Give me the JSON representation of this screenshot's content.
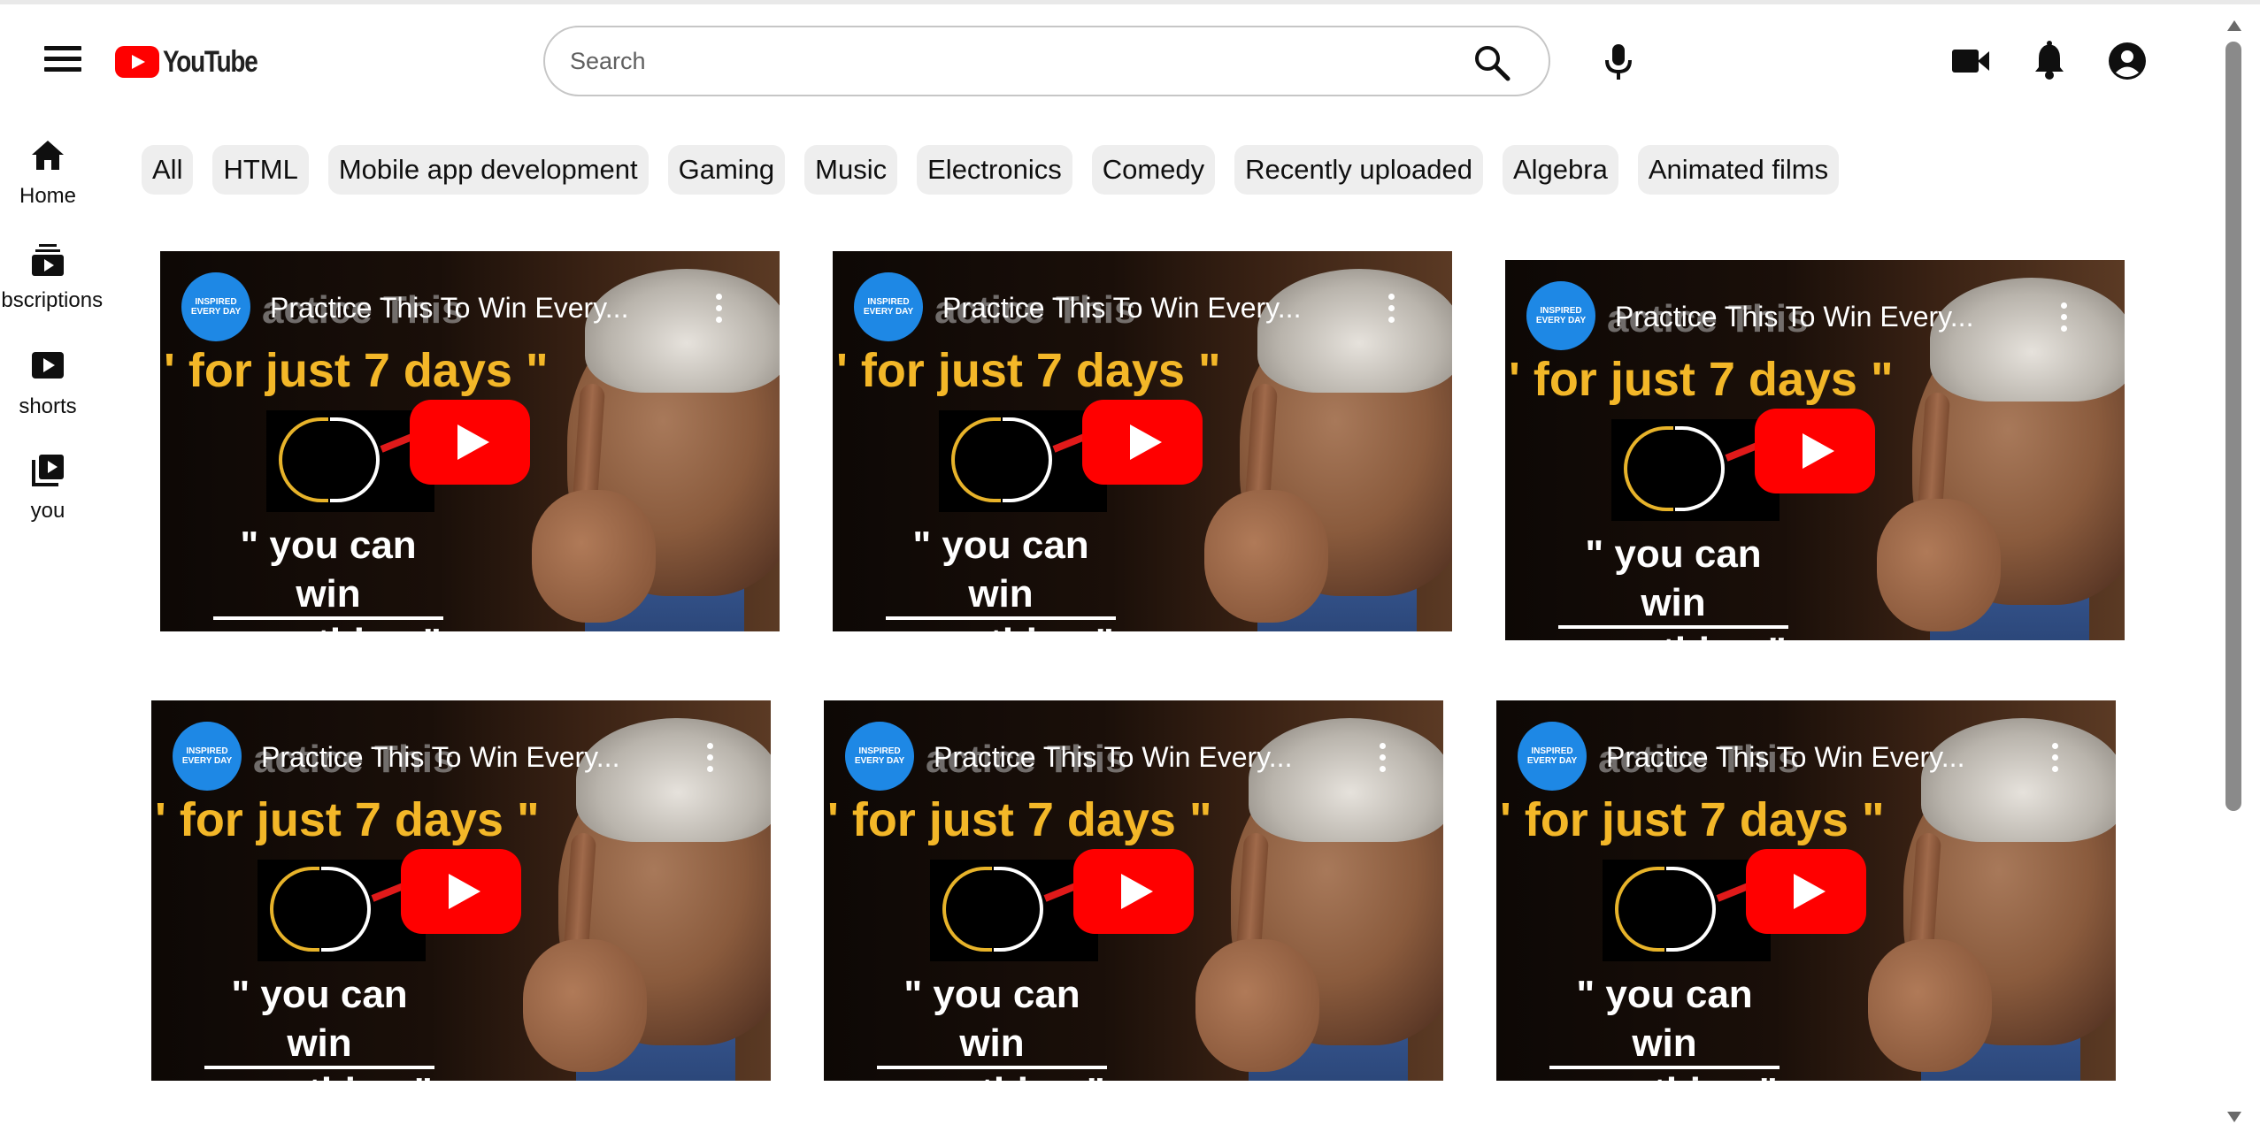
{
  "header": {
    "logo_text": "YouTube",
    "search": {
      "placeholder": "Search",
      "value": ""
    }
  },
  "sidebar": {
    "items": [
      {
        "label": "Home",
        "icon": "home-icon"
      },
      {
        "label": "ubscriptions",
        "icon": "subscriptions-icon"
      },
      {
        "label": "shorts",
        "icon": "shorts-icon"
      },
      {
        "label": "you",
        "icon": "you-icon"
      }
    ]
  },
  "chips": [
    "All",
    "HTML",
    "Mobile app development",
    "Gaming",
    "Music",
    "Electronics",
    "Comedy",
    "Recently uploaded",
    "Algebra",
    "Animated films"
  ],
  "videos": [
    {
      "channel": "INSPIRED EVERY DAY",
      "title": "Practice This To Win Every...",
      "ghost": "actice This",
      "line1": "' for just 7 days \"",
      "line2": "\" you can win everything \""
    },
    {
      "channel": "INSPIRED EVERY DAY",
      "title": "Practice This To Win Every...",
      "ghost": "actice This",
      "line1": "' for just 7 days \"",
      "line2": "\" you can win everything \""
    },
    {
      "channel": "INSPIRED EVERY DAY",
      "title": "Practice This To Win Every...",
      "ghost": "actice This",
      "line1": "' for just 7 days \"",
      "line2": "\" you can win everything \""
    },
    {
      "channel": "INSPIRED EVERY DAY",
      "title": "Practice This To Win Every...",
      "ghost": "actice This",
      "line1": "' for just 7 days \"",
      "line2": "\" you can win everything \""
    },
    {
      "channel": "INSPIRED EVERY DAY",
      "title": "Practice This To Win Every...",
      "ghost": "actice This",
      "line1": "' for just 7 days \"",
      "line2": "\" you can win everything \""
    },
    {
      "channel": "INSPIRED EVERY DAY",
      "title": "Practice This To Win Every...",
      "ghost": "actice This",
      "line1": "' for just 7 days \"",
      "line2": "\" you can win everything \""
    }
  ],
  "colors": {
    "brand_red": "#ff0000",
    "text": "#0f0f0f",
    "chip_bg": "#eeeeee",
    "title_yellow": "#f3b728"
  }
}
